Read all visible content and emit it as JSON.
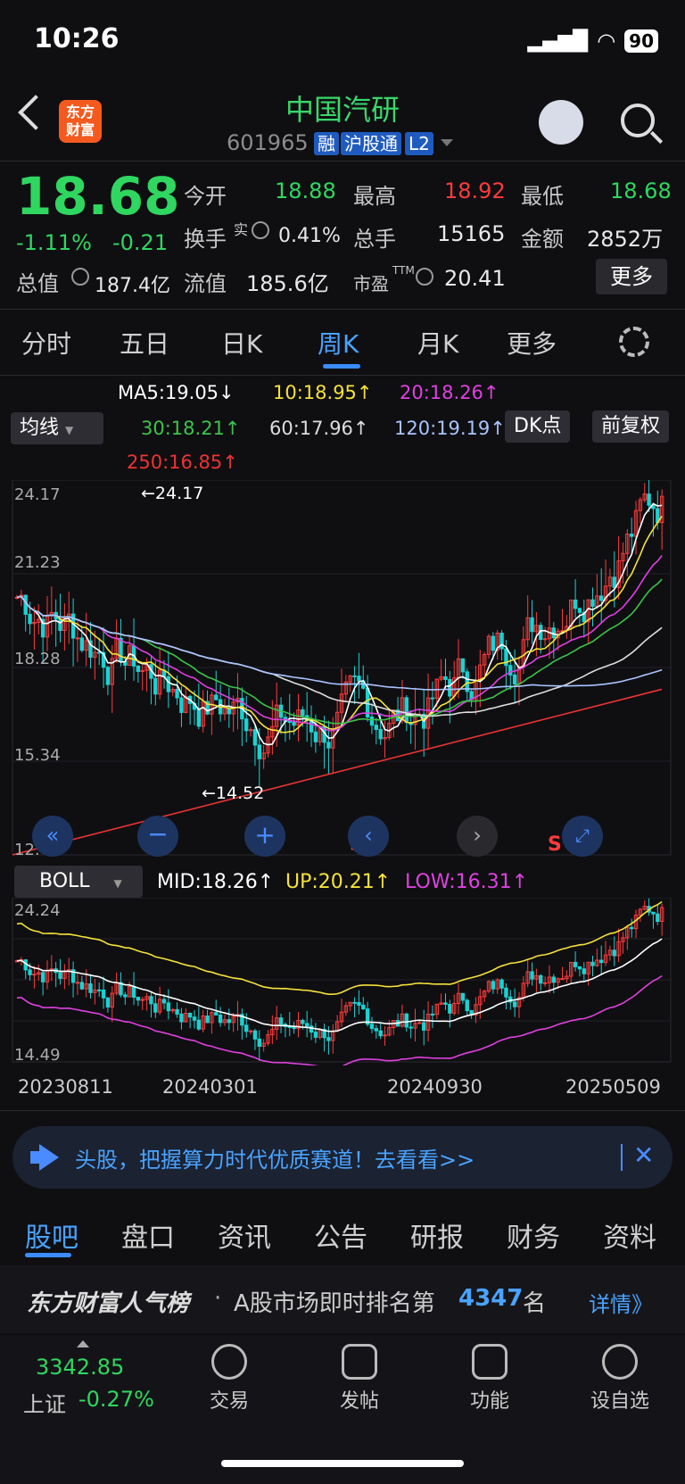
{
  "status": {
    "time": "10:26",
    "battery": "90"
  },
  "header": {
    "name": "中国汽研",
    "code": "601965",
    "tags": [
      "融",
      "沪股通",
      "L2"
    ],
    "logo": "东方\n财富"
  },
  "quote": {
    "price": "18.68",
    "change_pct": "-1.11%",
    "change": "-0.21",
    "open_label": "今开",
    "open": "18.88",
    "high_label": "最高",
    "high": "18.92",
    "low_label": "最低",
    "low": "18.68",
    "turnover_label": "换手",
    "turnover_sup": "实",
    "turnover": "0.41%",
    "volume_label": "总手",
    "volume": "15165",
    "amount_label": "金额",
    "amount": "2852万",
    "mcap_label": "总值",
    "mcap": "187.4亿",
    "float_label": "流值",
    "float": "185.6亿",
    "pe_label": "市盈",
    "pe_sup": "TTM",
    "pe": "20.41",
    "more": "更多"
  },
  "period_tabs": [
    "分时",
    "五日",
    "日K",
    "周K",
    "月K",
    "更多"
  ],
  "ma": {
    "selector": "均线",
    "ma5": "MA5:19.05↓",
    "ma10": "10:18.95↑",
    "ma20": "20:18.26↑",
    "ma30": "30:18.21↑",
    "ma60": "60:17.96↑",
    "ma120": "120:19.19↑",
    "ma250": "250:16.85↑",
    "dk": "DK点",
    "adjust": "前复权"
  },
  "chart": {
    "y_labels": [
      "24.17",
      "21.23",
      "18.28",
      "15.34",
      "12.40"
    ],
    "max_label": "←24.17",
    "min_label": "←14.52",
    "td_numbers": [
      "1",
      "2",
      "3",
      "4",
      "5",
      "6",
      "7",
      "8",
      "9",
      "2",
      "3",
      "4",
      "5",
      "6",
      "7",
      "8",
      "9"
    ],
    "s_labels": [
      "S",
      "S"
    ]
  },
  "boll": {
    "selector": "BOLL",
    "mid": "MID:18.26↑",
    "up": "UP:20.21↑",
    "low": "LOW:16.31↑",
    "y_top": "24.24",
    "y_bottom": "14.49"
  },
  "dates": [
    "20230811",
    "20240301",
    "20240930",
    "20250509"
  ],
  "banner": {
    "text": "头股，把握算力时代优质赛道！去看看>>"
  },
  "bottom_tabs": [
    "股吧",
    "盘口",
    "资讯",
    "公告",
    "研报",
    "财务",
    "资料"
  ],
  "rank": {
    "brand": "东方财富人气榜",
    "dot": "·",
    "text_pre": "A股市场即时排名第",
    "rank": "4347",
    "text_post": "名",
    "detail": "详情》"
  },
  "index": {
    "value": "3342.85",
    "name": "上证",
    "change": "-0.27%"
  },
  "nav": [
    "交易",
    "发帖",
    "功能",
    "设自选"
  ],
  "colors": {
    "up": "#ff3b3b",
    "down": "#2fd760",
    "accent": "#3b8cff"
  }
}
